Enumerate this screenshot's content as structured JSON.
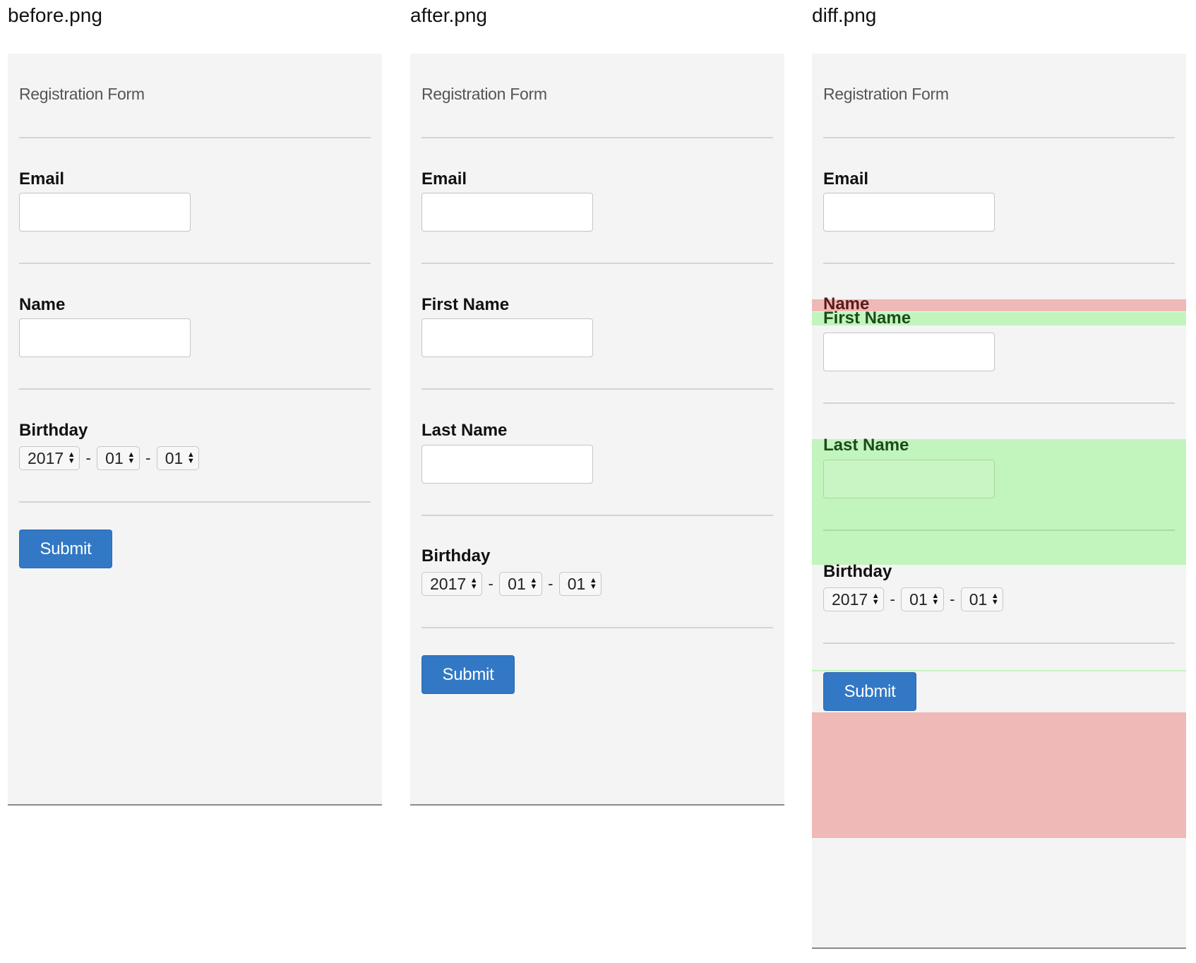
{
  "panels": {
    "before": {
      "filename": "before.png",
      "form_title": "Registration Form",
      "email_label": "Email",
      "name_label": "Name",
      "birthday_label": "Birthday",
      "birthday": {
        "year": "2017",
        "month": "01",
        "day": "01",
        "separator": "-"
      },
      "submit_label": "Submit"
    },
    "after": {
      "filename": "after.png",
      "form_title": "Registration Form",
      "email_label": "Email",
      "first_name_label": "First Name",
      "last_name_label": "Last Name",
      "birthday_label": "Birthday",
      "birthday": {
        "year": "2017",
        "month": "01",
        "day": "01",
        "separator": "-"
      },
      "submit_label": "Submit"
    },
    "diff": {
      "filename": "diff.png",
      "form_title": "Registration Form",
      "email_label": "Email",
      "removed_name_label": "Name",
      "first_name_label": "First Name",
      "last_name_label": "Last Name",
      "birthday_label": "Birthday",
      "birthday": {
        "year": "2017",
        "month": "01",
        "day": "01",
        "separator": "-"
      },
      "submit_label": "Submit"
    }
  },
  "colors": {
    "panel_bg": "#f4f4f4",
    "submit_bg": "#3278c5",
    "diff_removed": "#eeb9b6",
    "diff_added": "#c2f4bd"
  },
  "icons": {
    "select_arrows": "up-down-arrows-icon"
  }
}
